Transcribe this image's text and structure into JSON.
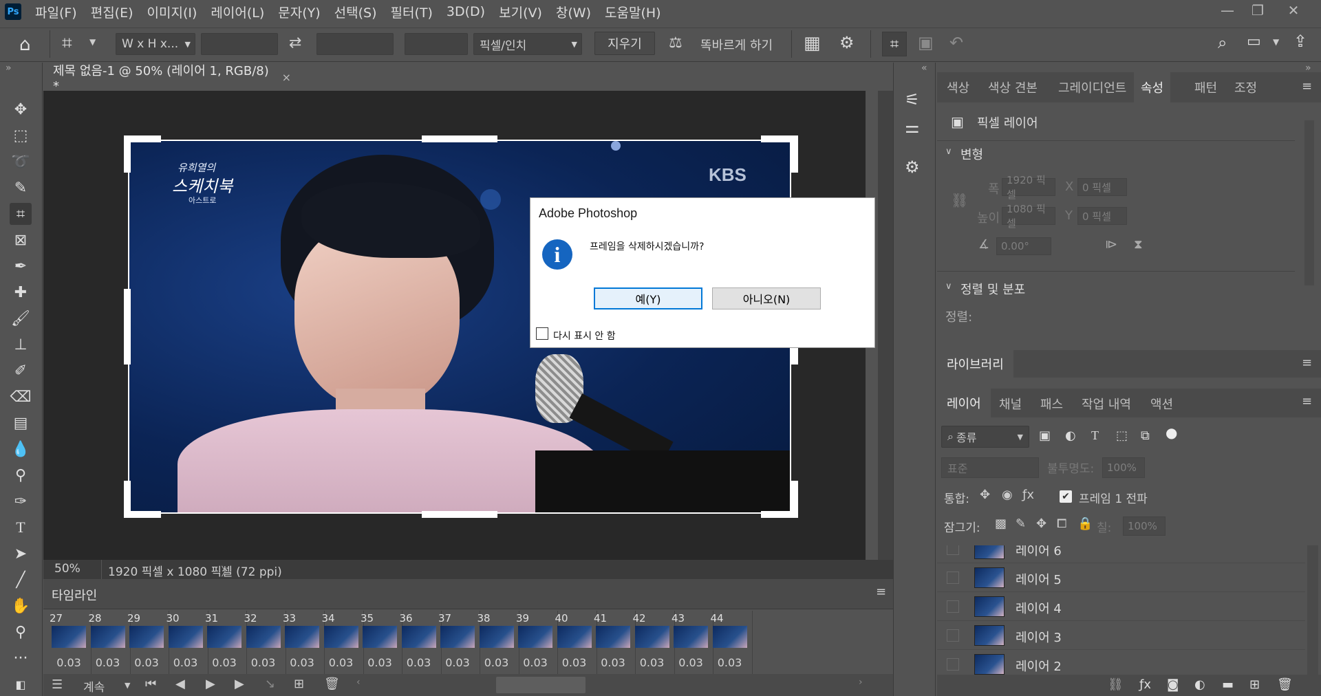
{
  "menubar": {
    "logo": "Ps",
    "items": [
      "파일(F)",
      "편집(E)",
      "이미지(I)",
      "레이어(L)",
      "문자(Y)",
      "선택(S)",
      "필터(T)",
      "3D(D)",
      "보기(V)",
      "창(W)",
      "도움말(H)"
    ]
  },
  "options": {
    "ratio_select": "W x H x...",
    "units_select": "픽셀/인치",
    "clear_label": "지우기",
    "straighten_label": "똑바르게 하기"
  },
  "document": {
    "tab_title": "제목 없음-1 @ 50% (레이어 1, RGB/8) *",
    "close": "×"
  },
  "image": {
    "watermark_line1": "유희열의",
    "watermark_line2": "스케치북",
    "watermark_line3": "아스트로",
    "broadcaster": "KBS"
  },
  "status": {
    "zoom": "50%",
    "doc_info": "1920 픽셀 x 1080 픽셀 (72 ppi)",
    "arrow": "〉"
  },
  "timeline": {
    "title": "타임라인",
    "frames": [
      {
        "num": "27",
        "delay": "0.03"
      },
      {
        "num": "28",
        "delay": "0.03"
      },
      {
        "num": "29",
        "delay": "0.03"
      },
      {
        "num": "30",
        "delay": "0.03"
      },
      {
        "num": "31",
        "delay": "0.03"
      },
      {
        "num": "32",
        "delay": "0.03"
      },
      {
        "num": "33",
        "delay": "0.03"
      },
      {
        "num": "34",
        "delay": "0.03"
      },
      {
        "num": "35",
        "delay": "0.03"
      },
      {
        "num": "36",
        "delay": "0.03"
      },
      {
        "num": "37",
        "delay": "0.03"
      },
      {
        "num": "38",
        "delay": "0.03"
      },
      {
        "num": "39",
        "delay": "0.03"
      },
      {
        "num": "40",
        "delay": "0.03"
      },
      {
        "num": "41",
        "delay": "0.03"
      },
      {
        "num": "42",
        "delay": "0.03"
      },
      {
        "num": "43",
        "delay": "0.03"
      },
      {
        "num": "44",
        "delay": "0.03"
      }
    ],
    "loop_label": "계속"
  },
  "panel_tabs_top": [
    "색상",
    "색상 견본",
    "그레이디언트",
    "속성",
    "패턴",
    "조정"
  ],
  "properties": {
    "layer_type": "픽셀 레이어",
    "transform_title": "변형",
    "width_label": "폭",
    "width_value": "1920 픽셀",
    "height_label": "높이",
    "height_value": "1080 픽셀",
    "x_label": "X",
    "x_value": "0 픽셀",
    "y_label": "Y",
    "y_value": "0 픽셀",
    "angle_value": "0.00°",
    "align_title": "정렬 및 분포",
    "align_label": "정렬:"
  },
  "libraries": {
    "title": "라이브러리"
  },
  "layer_tabs": [
    "레이어",
    "채널",
    "패스",
    "작업 내역",
    "액션"
  ],
  "layers_panel": {
    "filter_kind": "종류",
    "blend_mode": "표준",
    "opacity_label": "불투명도:",
    "opacity_value": "100%",
    "unify_label": "통합:",
    "propagate_label": "프레임 1 전파",
    "lock_label": "잠그기:",
    "fill_label": "칠:",
    "fill_value": "100%",
    "layers": [
      "레이어 6",
      "레이어 5",
      "레이어 4",
      "레이어 3",
      "레이어 2"
    ]
  },
  "dialog": {
    "title": "Adobe Photoshop",
    "message": "프레임을 삭제하시겠습니까?",
    "yes": "예(Y)",
    "no": "아니오(N)",
    "dont_show": "다시 표시 안 함"
  }
}
